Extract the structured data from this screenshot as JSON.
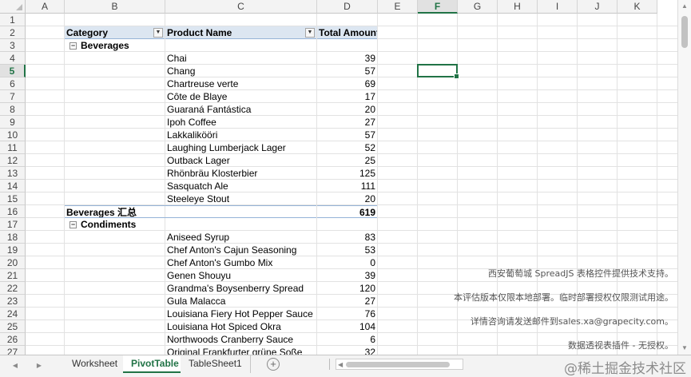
{
  "columns": [
    "A",
    "B",
    "C",
    "D",
    "E",
    "F",
    "G",
    "H",
    "I",
    "J",
    "K"
  ],
  "selected_column": "F",
  "selected_row": "5",
  "rows": [
    "1",
    "2",
    "3",
    "4",
    "5",
    "6",
    "7",
    "8",
    "9",
    "10",
    "11",
    "12",
    "13",
    "14",
    "15",
    "16",
    "17",
    "18",
    "19",
    "20",
    "21",
    "22",
    "23",
    "24",
    "25",
    "26",
    "27"
  ],
  "pivot": {
    "headers": {
      "category": "Category",
      "product": "Product Name",
      "total": "Total Amount"
    },
    "groups": [
      {
        "name": "Beverages",
        "collapse_symbol": "−",
        "items": [
          {
            "product": "Chai",
            "amount": "39"
          },
          {
            "product": "Chang",
            "amount": "57"
          },
          {
            "product": "Chartreuse verte",
            "amount": "69"
          },
          {
            "product": "Côte de Blaye",
            "amount": "17"
          },
          {
            "product": "Guaraná Fantástica",
            "amount": "20"
          },
          {
            "product": "Ipoh Coffee",
            "amount": "27"
          },
          {
            "product": "Lakkalikööri",
            "amount": "57"
          },
          {
            "product": "Laughing Lumberjack Lager",
            "amount": "52"
          },
          {
            "product": "Outback Lager",
            "amount": "25"
          },
          {
            "product": "Rhönbräu Klosterbier",
            "amount": "125"
          },
          {
            "product": "Sasquatch Ale",
            "amount": "111"
          },
          {
            "product": "Steeleye Stout",
            "amount": "20"
          }
        ],
        "subtotal_label": "Beverages 汇总",
        "subtotal_value": "619"
      },
      {
        "name": "Condiments",
        "collapse_symbol": "−",
        "items": [
          {
            "product": "Aniseed Syrup",
            "amount": "83"
          },
          {
            "product": "Chef Anton's Cajun Seasoning",
            "amount": "53"
          },
          {
            "product": "Chef Anton's Gumbo Mix",
            "amount": "0"
          },
          {
            "product": "Genen Shouyu",
            "amount": "39"
          },
          {
            "product": "Grandma's Boysenberry Spread",
            "amount": "120"
          },
          {
            "product": "Gula Malacca",
            "amount": "27"
          },
          {
            "product": "Louisiana Fiery Hot Pepper Sauce",
            "amount": "76"
          },
          {
            "product": "Louisiana Hot Spiced Okra",
            "amount": "104"
          },
          {
            "product": "Northwoods Cranberry Sauce",
            "amount": "6"
          },
          {
            "product": "Original Frankfurter grüne Soße",
            "amount": "32"
          }
        ]
      }
    ]
  },
  "watermark": [
    "西安葡萄城 SpreadJS 表格控件提供技术支持。",
    "本评估版本仅限本地部署。临时部署授权仅限测试用途。",
    "详情咨询请发送邮件到sales.xa@grapecity.com。",
    "数据透视表插件 - 无授权。"
  ],
  "sheet_tabs": [
    {
      "label": "Worksheet",
      "active": false
    },
    {
      "label": "PivotTable",
      "active": true
    },
    {
      "label": "TableSheet1",
      "active": false
    }
  ],
  "add_sheet_symbol": "+",
  "brand_text": "@稀土掘金技术社区",
  "colors": {
    "accent": "#217346",
    "header_fill": "#dce6f1",
    "header_border": "#95b3d7"
  }
}
